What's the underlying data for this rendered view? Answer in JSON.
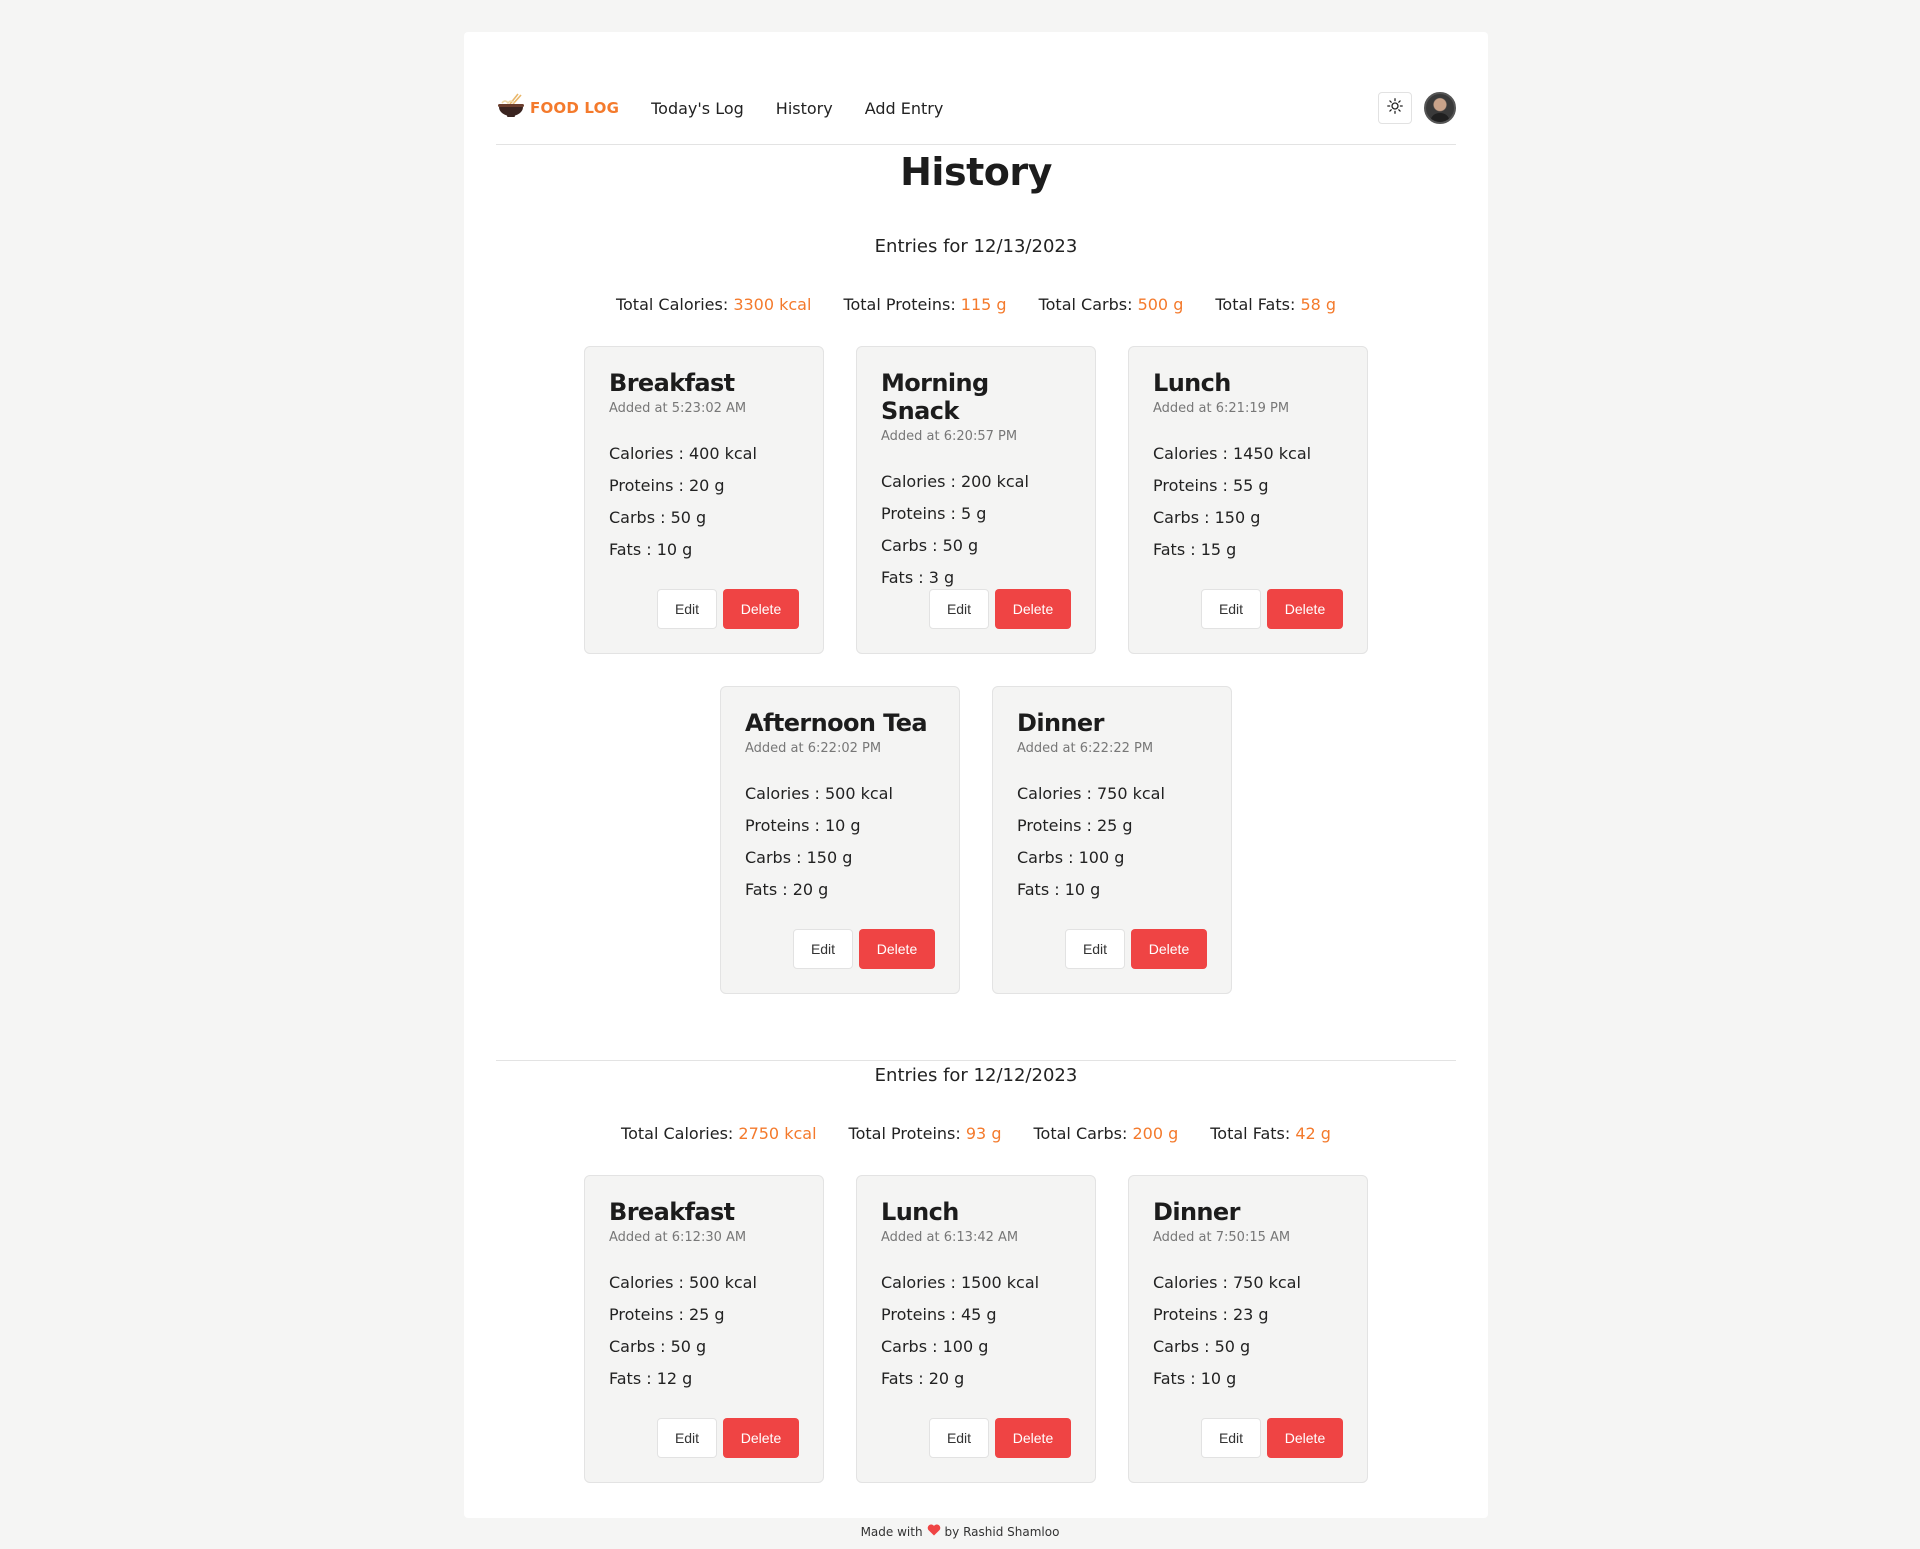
{
  "nav": {
    "logo_text": "FOOD LOG",
    "links": [
      "Today's Log",
      "History",
      "Add Entry"
    ]
  },
  "page_title": "History",
  "days": [
    {
      "heading": "Entries for 12/13/2023",
      "totals": {
        "calories_label": "Total Calories:",
        "calories": "3300 kcal",
        "proteins_label": "Total Proteins:",
        "proteins": "115 g",
        "carbs_label": "Total Carbs:",
        "carbs": "500 g",
        "fats_label": "Total Fats:",
        "fats": "58 g"
      },
      "entries": [
        {
          "title": "Breakfast",
          "added": "Added at 5:23:02 AM",
          "calories": "Calories : 400 kcal",
          "proteins": "Proteins : 20 g",
          "carbs": "Carbs : 50 g",
          "fats": "Fats : 10 g"
        },
        {
          "title": "Morning Snack",
          "added": "Added at 6:20:57 PM",
          "calories": "Calories : 200 kcal",
          "proteins": "Proteins : 5 g",
          "carbs": "Carbs : 50 g",
          "fats": "Fats : 3 g"
        },
        {
          "title": "Lunch",
          "added": "Added at 6:21:19 PM",
          "calories": "Calories : 1450 kcal",
          "proteins": "Proteins : 55 g",
          "carbs": "Carbs : 150 g",
          "fats": "Fats : 15 g"
        },
        {
          "title": "Afternoon Tea",
          "added": "Added at 6:22:02 PM",
          "calories": "Calories : 500 kcal",
          "proteins": "Proteins : 10 g",
          "carbs": "Carbs : 150 g",
          "fats": "Fats : 20 g"
        },
        {
          "title": "Dinner",
          "added": "Added at 6:22:22 PM",
          "calories": "Calories : 750 kcal",
          "proteins": "Proteins : 25 g",
          "carbs": "Carbs : 100 g",
          "fats": "Fats : 10 g"
        }
      ]
    },
    {
      "heading": "Entries for 12/12/2023",
      "totals": {
        "calories_label": "Total Calories:",
        "calories": "2750 kcal",
        "proteins_label": "Total Proteins:",
        "proteins": "93 g",
        "carbs_label": "Total Carbs:",
        "carbs": "200 g",
        "fats_label": "Total Fats:",
        "fats": "42 g"
      },
      "entries": [
        {
          "title": "Breakfast",
          "added": "Added at 6:12:30 AM",
          "calories": "Calories : 500 kcal",
          "proteins": "Proteins : 25 g",
          "carbs": "Carbs : 50 g",
          "fats": "Fats : 12 g"
        },
        {
          "title": "Lunch",
          "added": "Added at 6:13:42 AM",
          "calories": "Calories : 1500 kcal",
          "proteins": "Proteins : 45 g",
          "carbs": "Carbs : 100 g",
          "fats": "Fats : 20 g"
        },
        {
          "title": "Dinner",
          "added": "Added at 7:50:15 AM",
          "calories": "Calories : 750 kcal",
          "proteins": "Proteins : 23 g",
          "carbs": "Carbs : 50 g",
          "fats": "Fats : 10 g"
        }
      ]
    }
  ],
  "buttons": {
    "edit": "Edit",
    "delete": "Delete"
  },
  "footer": {
    "made_with": "Made with",
    "by": "by Rashid Shamloo"
  },
  "colors": {
    "accent": "#f47a2c",
    "danger": "#ef4444",
    "heart": "#ef4444"
  },
  "icons": {
    "logo": "noodle-bowl-icon",
    "theme": "sun-icon",
    "heart": "heart-icon"
  }
}
